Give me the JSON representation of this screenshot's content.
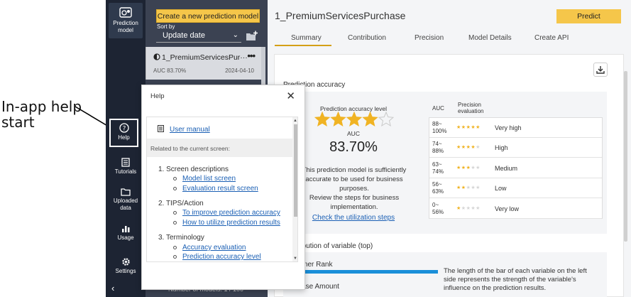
{
  "annotation": {
    "line1": "In-app help",
    "line2": "start"
  },
  "sidenav": {
    "items": [
      {
        "label_lines": [
          "Prediction",
          "model"
        ],
        "icon": "prediction-model-icon"
      },
      {
        "label_lines": [
          "Help"
        ],
        "icon": "help-icon"
      },
      {
        "label_lines": [
          "Tutorials"
        ],
        "icon": "tutorials-icon"
      },
      {
        "label_lines": [
          "Uploaded",
          "data"
        ],
        "icon": "folder-icon"
      },
      {
        "label_lines": [
          "Usage"
        ],
        "icon": "usage-icon"
      },
      {
        "label_lines": [
          "Settings"
        ],
        "icon": "gear-icon"
      }
    ],
    "collapse_glyph": "‹"
  },
  "list": {
    "create_button": "Create a new prediction model",
    "sort_label": "Sort by",
    "sort_value": "Update date",
    "model": {
      "title": "1_PremiumServicesPur···",
      "menu": "•••",
      "auc": "AUC 83.70%",
      "date": "2024-04-10"
    },
    "model_count": "Number of models: 1 / 100"
  },
  "help": {
    "title": "Help",
    "close": "✕",
    "manual": "User manual",
    "related": "Related to the current screen:",
    "sections": [
      {
        "title": "1. Screen descriptions",
        "links": [
          "Model list screen",
          "Evaluation result screen"
        ]
      },
      {
        "title": "2. TIPS/Action",
        "links": [
          "To improve prediction accuracy",
          "How to utilize prediction results"
        ]
      },
      {
        "title": "3. Terminology",
        "links": [
          "Accuracy evaluation",
          "Prediction accuracy level"
        ]
      }
    ]
  },
  "main": {
    "title": "1_PremiumServicesPurchase",
    "predict_button": "Predict",
    "tabs": [
      "Summary",
      "Contribution",
      "Precision",
      "Model Details",
      "Create API"
    ],
    "active_tab": "Summary",
    "accuracy": {
      "section_title": "Prediction accuracy",
      "level_label": "Prediction accuracy level",
      "stars_filled": 4,
      "stars_total": 5,
      "auc_label": "AUC",
      "auc_value": "83.70%",
      "description": [
        "This prediction model is sufficiently",
        "accurate to be used for business",
        "purposes.",
        "Review the steps for business",
        "implementation."
      ],
      "util_link": "Check the utilization steps"
    },
    "table": {
      "col_auc": "AUC",
      "col_precision": [
        "Precision",
        "evaluation"
      ],
      "rows": [
        {
          "range": [
            "88~",
            "100%"
          ],
          "stars": 5,
          "eval": "Very high"
        },
        {
          "range": [
            "74~",
            "88%"
          ],
          "stars": 4,
          "eval": "High"
        },
        {
          "range": [
            "63~",
            "74%"
          ],
          "stars": 3,
          "eval": "Medium"
        },
        {
          "range": [
            "56~",
            "63%"
          ],
          "stars": 2,
          "eval": "Low"
        },
        {
          "range": [
            "0~",
            "56%"
          ],
          "stars": 1,
          "eval": "Very low"
        }
      ]
    },
    "contribution": {
      "section_title": "Contribution of variable (top)",
      "var1": "Customer Rank",
      "var2": "Purchase Amount",
      "description": "The length of the bar of each variable on the left side represents the strength of the variable's influence on the prediction results."
    }
  },
  "colors": {
    "accent": "#f5c64a",
    "nav_bg": "#1d2433",
    "list_bg": "#3b4252",
    "link": "#1a5fb4",
    "star": "#f0b323",
    "bar": "#1a8fd9"
  }
}
